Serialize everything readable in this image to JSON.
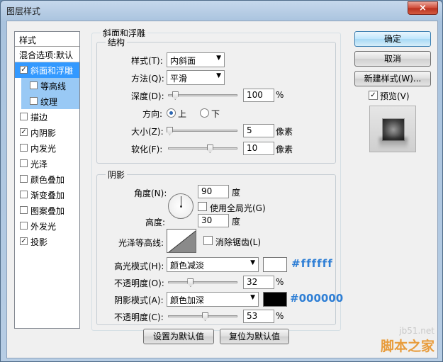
{
  "window": {
    "title": "图层样式",
    "close_label": "×"
  },
  "style_list": {
    "header": "样式",
    "blend_options": "混合选项:默认",
    "items": [
      {
        "label": "斜面和浮雕",
        "checked": "✓"
      },
      {
        "label": "等高线",
        "checked": ""
      },
      {
        "label": "纹理",
        "checked": ""
      },
      {
        "label": "描边",
        "checked": ""
      },
      {
        "label": "内阴影",
        "checked": "✓"
      },
      {
        "label": "内发光",
        "checked": ""
      },
      {
        "label": "光泽",
        "checked": ""
      },
      {
        "label": "颜色叠加",
        "checked": ""
      },
      {
        "label": "渐变叠加",
        "checked": ""
      },
      {
        "label": "图案叠加",
        "checked": ""
      },
      {
        "label": "外发光",
        "checked": ""
      },
      {
        "label": "投影",
        "checked": "✓"
      }
    ]
  },
  "bevel": {
    "title": "斜面和浮雕",
    "structure": {
      "title": "结构",
      "style_label": "样式(T):",
      "style_value": "内斜面",
      "technique_label": "方法(Q):",
      "technique_value": "平滑",
      "depth_label": "深度(D):",
      "depth_value": "100",
      "depth_unit": "%",
      "depth_fraction": 0.1,
      "direction_label": "方向:",
      "direction_up": "上",
      "direction_down": "下",
      "size_label": "大小(Z):",
      "size_value": "5",
      "size_unit": "像素",
      "size_fraction": 0.02,
      "soften_label": "软化(F):",
      "soften_value": "10",
      "soften_unit": "像素",
      "soften_fraction": 0.6
    },
    "shading": {
      "title": "阴影",
      "angle_label": "角度(N):",
      "angle_value": "90",
      "angle_unit": "度",
      "global_light_label": "使用全局光(G)",
      "altitude_label": "高度:",
      "altitude_value": "30",
      "altitude_unit": "度",
      "gloss_contour_label": "光泽等高线:",
      "anti_alias_label": "消除锯齿(L)",
      "highlight_mode_label": "高光模式(H):",
      "highlight_mode_value": "颜色减淡",
      "highlight_color": "#ffffff",
      "highlight_hex": "#ffffff",
      "highlight_opacity_label": "不透明度(O):",
      "highlight_opacity_value": "32",
      "highlight_opacity_unit": "%",
      "highlight_opacity_fraction": 0.32,
      "shadow_mode_label": "阴影模式(A):",
      "shadow_mode_value": "颜色加深",
      "shadow_color": "#000000",
      "shadow_hex": "#000000",
      "shadow_opacity_label": "不透明度(C):",
      "shadow_opacity_value": "53",
      "shadow_opacity_unit": "%",
      "shadow_opacity_fraction": 0.53
    },
    "make_default": "设置为默认值",
    "reset_default": "复位为默认值"
  },
  "actions": {
    "ok": "确定",
    "cancel": "取消",
    "new_style": "新建样式(W)...",
    "preview_label": "预览(V)",
    "preview_checked": "✓"
  },
  "watermark": {
    "site": "jb51.net",
    "brand": "脚本之家"
  },
  "colors": {
    "accent_hex": "#2f7fd5",
    "selection": "#3399ff"
  }
}
